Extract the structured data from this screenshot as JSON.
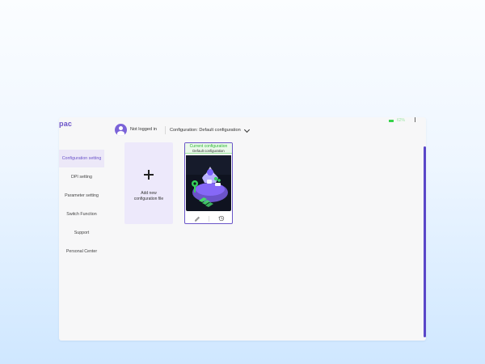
{
  "app": {
    "logo_text": "pac"
  },
  "header": {
    "login_status": "Not logged in",
    "config_label": "Configuration: Default configuration",
    "battery_text": "62%",
    "colors": {
      "accent": "#6b53c9",
      "battery": "#37d34a"
    }
  },
  "sidebar": {
    "items": [
      {
        "label": "Configuration setting",
        "active": true
      },
      {
        "label": "DPI setting"
      },
      {
        "label": "Parameter setting"
      },
      {
        "label": "Switch Function"
      },
      {
        "label": "Support"
      },
      {
        "label": "Personal Center"
      }
    ]
  },
  "main": {
    "new_config": {
      "label_line1": "Add new",
      "label_line2": "configuration file",
      "icon": "plus-icon"
    },
    "current_config": {
      "title": "Current configuration",
      "subtitle": "Default configuration",
      "icons": [
        "edit-icon",
        "history-icon"
      ]
    }
  }
}
